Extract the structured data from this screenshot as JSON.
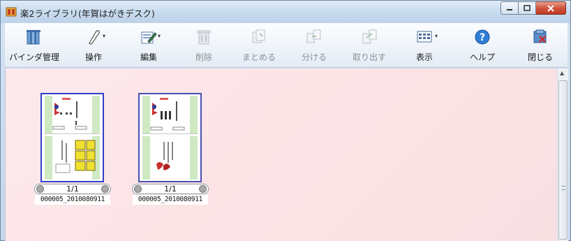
{
  "window": {
    "title": "楽2ライブラリ(年賀はがきデスク)"
  },
  "toolbar": {
    "items": [
      {
        "label": "バインダ管理",
        "icon": "binder-icon",
        "enabled": true
      },
      {
        "label": "操作",
        "icon": "operate-icon",
        "enabled": true,
        "dropdown": true
      },
      {
        "label": "編集",
        "icon": "edit-icon",
        "enabled": true,
        "dropdown": true
      },
      {
        "label": "削除",
        "icon": "trash-icon",
        "enabled": false
      },
      {
        "label": "まとめる",
        "icon": "merge-icon",
        "enabled": false
      },
      {
        "label": "分ける",
        "icon": "split-icon",
        "enabled": false
      },
      {
        "label": "取り出す",
        "icon": "extract-icon",
        "enabled": false
      },
      {
        "label": "表示",
        "icon": "view-icon",
        "enabled": true,
        "dropdown": true
      },
      {
        "label": "ヘルプ",
        "icon": "help-icon",
        "enabled": true
      },
      {
        "label": "閉じる",
        "icon": "close-binder-icon",
        "enabled": true
      }
    ]
  },
  "binders": [
    {
      "page": "1/1",
      "name": "000005_2010080911"
    },
    {
      "page": "1/1",
      "name": "000005_2010080911"
    }
  ],
  "colors": {
    "selection_border": "#3140c8",
    "content_background": "#fbe3e6",
    "close_button": "#c13a22"
  }
}
